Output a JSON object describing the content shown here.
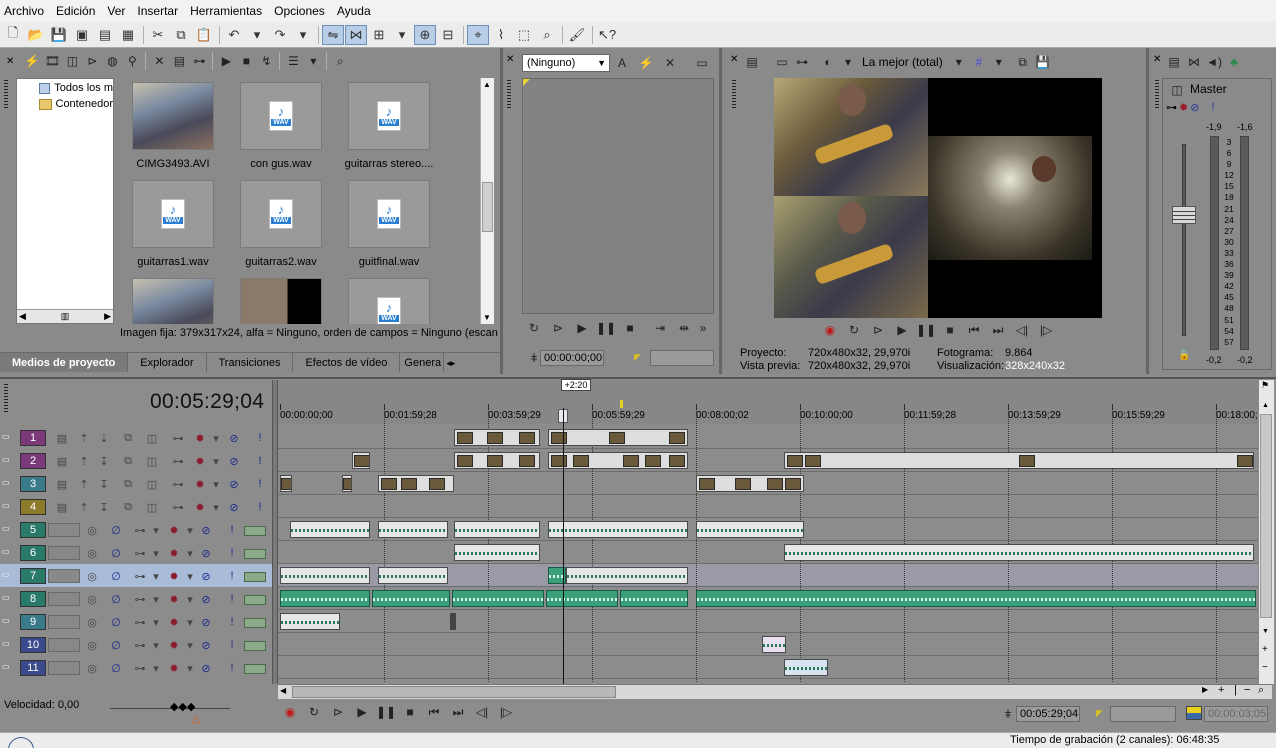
{
  "menu": [
    "Archivo",
    "Edición",
    "Ver",
    "Insertar",
    "Herramientas",
    "Opciones",
    "Ayuda"
  ],
  "explorer": {
    "tree": [
      "Todos los m",
      "Contenedor"
    ],
    "media": [
      {
        "name": "CIMG3493.AVI",
        "kind": "video"
      },
      {
        "name": "con gus.wav",
        "kind": "wav"
      },
      {
        "name": "guitarras stereo....",
        "kind": "wav"
      },
      {
        "name": "guitarras1.wav",
        "kind": "wav"
      },
      {
        "name": "guitarras2.wav",
        "kind": "wav"
      },
      {
        "name": "guitfinal.wav",
        "kind": "wav"
      },
      {
        "name": "",
        "kind": "video"
      },
      {
        "name": "",
        "kind": "video2"
      },
      {
        "name": "",
        "kind": "wav"
      }
    ],
    "wav_badge": "WAV",
    "status": "Imagen fija: 379x317x24, alfa = Ninguno, orden de campos = Ninguno (escan",
    "tabs": [
      "Medios de proyecto",
      "Explorador",
      "Transiciones",
      "Efectos de vídeo",
      "Genera"
    ]
  },
  "trimmer": {
    "selector": "(Ninguno)",
    "timecode": "00:00:00;00"
  },
  "preview": {
    "quality": "La mejor (total)",
    "proyecto_label": "Proyecto:",
    "proyecto_value": "720x480x32, 29,970i",
    "vista_label": "Vista previa:",
    "vista_value": "720x480x32, 29,970i",
    "fotograma_label": "Fotograma:",
    "fotograma_value": "9.864",
    "visualizacion_label": "Visualización:",
    "visualizacion_value": "328x240x32"
  },
  "mixer": {
    "master": "Master",
    "peak_left": "-1,9",
    "peak_right": "-1,6",
    "scale": [
      "3",
      "6",
      "9",
      "12",
      "15",
      "18",
      "21",
      "24",
      "27",
      "30",
      "33",
      "36",
      "39",
      "42",
      "45",
      "48",
      "51",
      "54",
      "57"
    ],
    "bottom_left": "-0,2",
    "bottom_right": "-0,2"
  },
  "timeline": {
    "big_timecode": "00:05:29;04",
    "marker": "+2:20",
    "ruler": [
      "00:00:00;00",
      "00:01:59;28",
      "00:03:59;29",
      "00:05:59;29",
      "00:08:00;02",
      "00:10:00;00",
      "00:11:59;28",
      "00:13:59;29",
      "00:15:59;29",
      "00:18:00;"
    ],
    "tracks": [
      {
        "num": "1",
        "type": "video"
      },
      {
        "num": "2",
        "type": "video"
      },
      {
        "num": "3",
        "type": "video"
      },
      {
        "num": "4",
        "type": "video"
      },
      {
        "num": "5",
        "type": "audio"
      },
      {
        "num": "6",
        "type": "audio"
      },
      {
        "num": "7",
        "type": "audio"
      },
      {
        "num": "8",
        "type": "audio"
      },
      {
        "num": "9",
        "type": "audio"
      },
      {
        "num": "10",
        "type": "audio"
      },
      {
        "num": "11",
        "type": "audio"
      }
    ],
    "speed": "Velocidad: 0,00",
    "cursor_tc": "00:05:29;04",
    "end_tc": "00:00:03;05"
  },
  "status": "Tiempo de grabación (2 canales): 06:48:35",
  "colors": {
    "track_video": "#7a3a7a",
    "track_audio": "#2a7a6a",
    "clip_green": "#3aa07a"
  }
}
